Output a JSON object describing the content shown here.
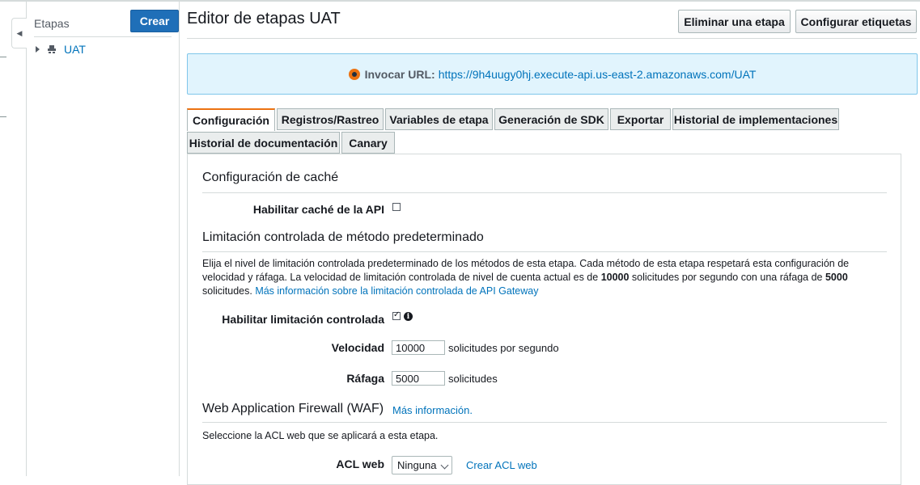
{
  "stages_panel": {
    "title": "Etapas",
    "create_button": "Crear",
    "items": [
      {
        "label": "UAT"
      }
    ]
  },
  "header": {
    "title": "Editor de etapas UAT",
    "delete_button": "Eliminar una etapa",
    "tags_button": "Configurar etiquetas"
  },
  "invoke": {
    "label": "Invocar URL:",
    "url": "https://9h4uugy0hj.execute-api.us-east-2.amazonaws.com/UAT"
  },
  "tabs": [
    {
      "label": "Configuración",
      "active": true
    },
    {
      "label": "Registros/Rastreo"
    },
    {
      "label": "Variables de etapa"
    },
    {
      "label": "Generación de SDK"
    },
    {
      "label": "Exportar"
    },
    {
      "label": "Historial de implementaciones"
    },
    {
      "label": "Historial de documentación"
    },
    {
      "label": "Canary"
    }
  ],
  "cache": {
    "title": "Configuración de caché",
    "enable_label": "Habilitar caché de la API",
    "enabled": false
  },
  "throttling": {
    "title": "Limitación controlada de método predeterminado",
    "desc_part1": "Elija el nivel de limitación controlada predeterminado de los métodos de esta etapa. Cada método de esta etapa respetará esta configuración de velocidad y ráfaga. La velocidad de limitación controlada de nivel de cuenta actual es de ",
    "desc_rate": "10000",
    "desc_part2": " solicitudes por segundo con una ráfaga de ",
    "desc_burst": "5000",
    "desc_part3": " solicitudes. ",
    "desc_link": "Más información sobre la limitación controlada de API Gateway",
    "enable_label": "Habilitar limitación controlada",
    "enabled": true,
    "rate_label": "Velocidad",
    "rate_value": "10000",
    "rate_unit": "solicitudes por segundo",
    "burst_label": "Ráfaga",
    "burst_value": "5000",
    "burst_unit": "solicitudes"
  },
  "waf": {
    "title": "Web Application Firewall (WAF)",
    "more_link": "Más información.",
    "desc": "Seleccione la ACL web que se aplicará a esta etapa.",
    "acl_label": "ACL web",
    "acl_value": "Ninguna",
    "create_link": "Crear ACL web"
  },
  "colors": {
    "primary": "#1f6fb8",
    "link": "#0073bb",
    "active_tab": "#ec7211",
    "info_bg": "#e1f4fd"
  }
}
